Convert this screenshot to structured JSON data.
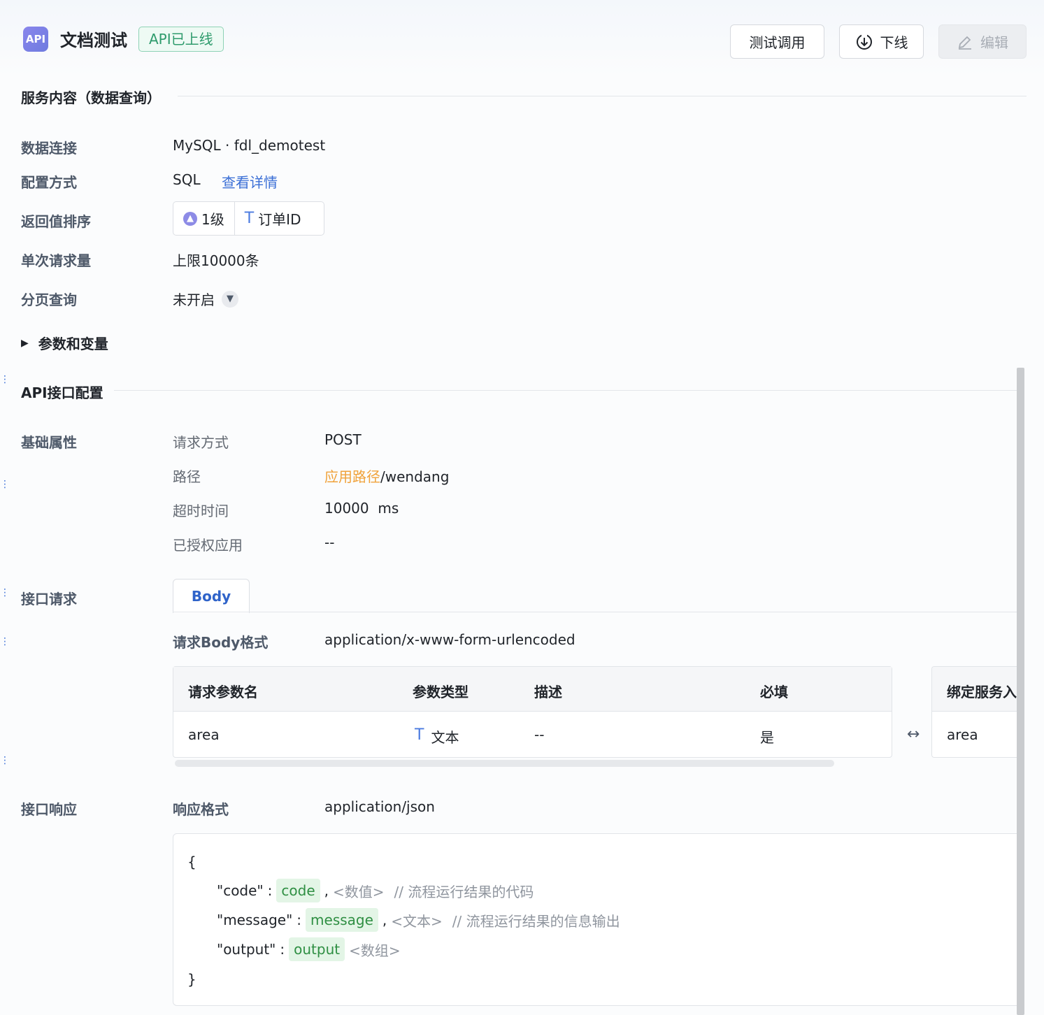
{
  "header": {
    "logo_text": "API",
    "title": "文档测试",
    "status": "API已上线",
    "buttons": {
      "test": "测试调用",
      "offline": "下线",
      "edit": "编辑"
    }
  },
  "service_section": {
    "title": "服务内容（数据查询）",
    "rows": {
      "connection_label": "数据连接",
      "connection_value": "MySQL · fdl_demotest",
      "config_label": "配置方式",
      "config_value": "SQL",
      "config_link": "查看详情",
      "sort_label": "返回值排序",
      "sort_level": "1级",
      "sort_field": "订单ID",
      "limit_label": "单次请求量",
      "limit_value": "上限10000条",
      "paging_label": "分页查询",
      "paging_value": "未开启"
    },
    "params_toggle": "参数和变量"
  },
  "api_section": {
    "title": "API接口配置",
    "basic": {
      "label": "基础属性",
      "method_label": "请求方式",
      "method_value": "POST",
      "path_label": "路径",
      "path_prefix": "应用路径",
      "path_suffix": "/wendang",
      "timeout_label": "超时时间",
      "timeout_value": "10000",
      "timeout_unit": "ms",
      "auth_label": "已授权应用",
      "auth_value": "--"
    },
    "request": {
      "label": "接口请求",
      "tab": "Body",
      "format_label": "请求Body格式",
      "format_value": "application/x-www-form-urlencoded",
      "columns": [
        "请求参数名",
        "参数类型",
        "描述",
        "必填"
      ],
      "row": {
        "name": "area",
        "type": "文本",
        "desc": "--",
        "required": "是"
      },
      "bind_column": "绑定服务入参",
      "bind_value": "area"
    },
    "response": {
      "label": "接口响应",
      "format_label": "响应格式",
      "format_value": "application/json",
      "json": {
        "open": "{",
        "close": "}",
        "lines": [
          {
            "key": "\"code\"",
            "pill": "code",
            "sep": ",",
            "type": "<数值>",
            "comment": "// 流程运行结果的代码"
          },
          {
            "key": "\"message\"",
            "pill": "message",
            "sep": ",",
            "type": "<文本>",
            "comment": "// 流程运行结果的信息输出"
          },
          {
            "key": "\"output\"",
            "pill": "output",
            "sep": "",
            "type": "<数组>",
            "comment": ""
          }
        ]
      }
    }
  },
  "colors": {
    "accent": "#3b6fd6",
    "status_green": "#2e9b6c",
    "path_orange": "#f0a23a"
  }
}
